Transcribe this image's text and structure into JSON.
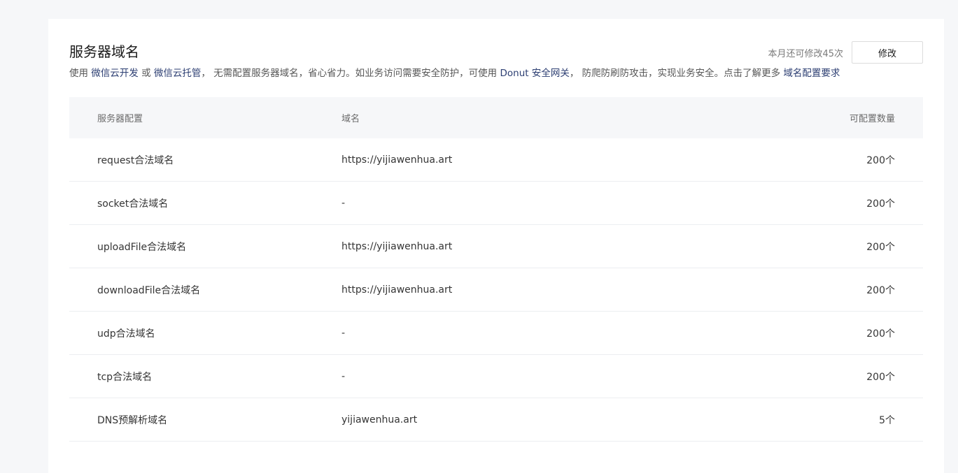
{
  "section": {
    "title": "服务器域名",
    "quota_text": "本月还可修改45次",
    "modify_label": "修改"
  },
  "description": {
    "p1": "使用 ",
    "link1": "微信云开发",
    "p2": " 或 ",
    "link2": "微信云托管",
    "p3": "， 无需配置服务器域名，省心省力。如业务访问需要安全防护，可使用 ",
    "link3": "Donut 安全网关",
    "p4": "， 防爬防刷防攻击，实现业务安全。点击了解更多 ",
    "link4": "域名配置要求"
  },
  "table": {
    "headers": {
      "config": "服务器配置",
      "domain": "域名",
      "count": "可配置数量"
    },
    "rows": [
      {
        "config": "request合法域名",
        "domain": "https://yijiawenhua.art",
        "count": "200个"
      },
      {
        "config": "socket合法域名",
        "domain": "-",
        "count": "200个"
      },
      {
        "config": "uploadFile合法域名",
        "domain": "https://yijiawenhua.art",
        "count": "200个"
      },
      {
        "config": "downloadFile合法域名",
        "domain": "https://yijiawenhua.art",
        "count": "200个"
      },
      {
        "config": "udp合法域名",
        "domain": "-",
        "count": "200个"
      },
      {
        "config": "tcp合法域名",
        "domain": "-",
        "count": "200个"
      },
      {
        "config": "DNS预解析域名",
        "domain": "yijiawenhua.art",
        "count": "5个"
      }
    ]
  }
}
